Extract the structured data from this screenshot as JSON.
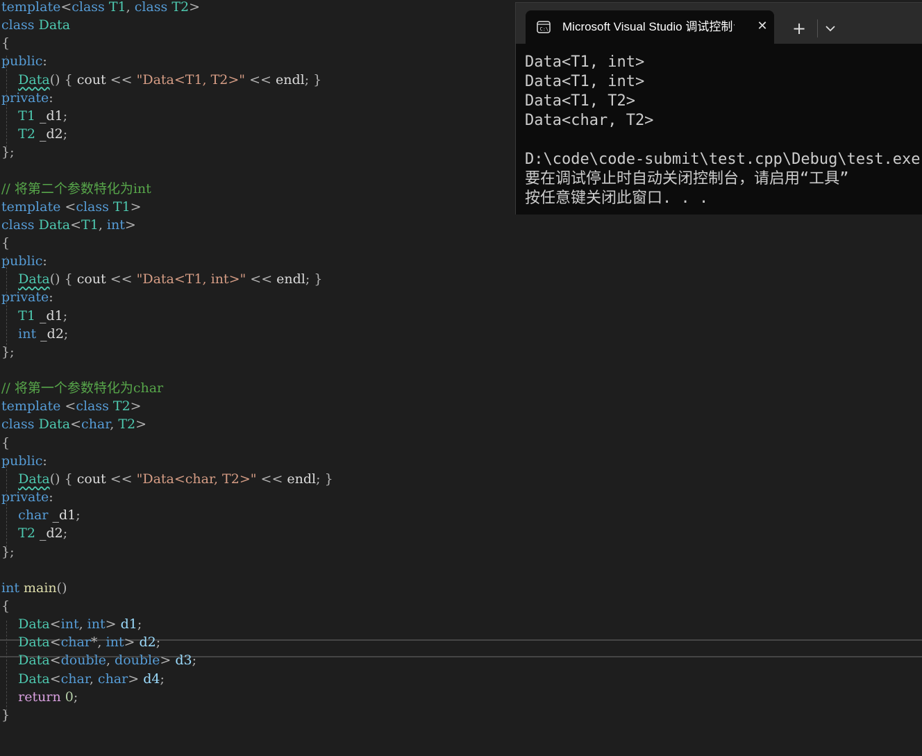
{
  "editor": {
    "lines": [
      [
        [
          "kw",
          "template"
        ],
        [
          "pu",
          "<"
        ],
        [
          "kw",
          "class"
        ],
        [
          "pl",
          " "
        ],
        [
          "ty",
          "T1"
        ],
        [
          "pu",
          ", "
        ],
        [
          "kw",
          "class"
        ],
        [
          "pl",
          " "
        ],
        [
          "ty",
          "T2"
        ],
        [
          "pu",
          ">"
        ]
      ],
      [
        [
          "kw",
          "class"
        ],
        [
          "pl",
          " "
        ],
        [
          "ty",
          "Data"
        ]
      ],
      [
        [
          "pu",
          "{"
        ]
      ],
      [
        [
          "kw",
          "public"
        ],
        [
          "pu",
          ":"
        ]
      ],
      [
        [
          "pl",
          "    "
        ],
        [
          "ty",
          "Data",
          "squig"
        ],
        [
          "pu",
          "() { "
        ],
        [
          "pl",
          "cout "
        ],
        [
          "pu",
          "<< "
        ],
        [
          "str",
          "\"Data<T1, T2>\""
        ],
        [
          "pu",
          " << "
        ],
        [
          "pl",
          "endl"
        ],
        [
          "pu",
          "; }"
        ]
      ],
      [
        [
          "kw",
          "private"
        ],
        [
          "pu",
          ":"
        ]
      ],
      [
        [
          "pl",
          "    "
        ],
        [
          "ty",
          "T1"
        ],
        [
          "pl",
          " _d1"
        ],
        [
          "pu",
          ";"
        ]
      ],
      [
        [
          "pl",
          "    "
        ],
        [
          "ty",
          "T2"
        ],
        [
          "pl",
          " _d2"
        ],
        [
          "pu",
          ";"
        ]
      ],
      [
        [
          "pu",
          "};"
        ]
      ],
      [],
      [
        [
          "cmt",
          "// 将第二个参数特化为int"
        ]
      ],
      [
        [
          "kw",
          "template"
        ],
        [
          "pl",
          " "
        ],
        [
          "pu",
          "<"
        ],
        [
          "kw",
          "class"
        ],
        [
          "pl",
          " "
        ],
        [
          "ty",
          "T1"
        ],
        [
          "pu",
          ">"
        ]
      ],
      [
        [
          "kw",
          "class"
        ],
        [
          "pl",
          " "
        ],
        [
          "ty",
          "Data"
        ],
        [
          "pu",
          "<"
        ],
        [
          "ty",
          "T1"
        ],
        [
          "pu",
          ", "
        ],
        [
          "kw",
          "int"
        ],
        [
          "pu",
          ">"
        ]
      ],
      [
        [
          "pu",
          "{"
        ]
      ],
      [
        [
          "kw",
          "public"
        ],
        [
          "pu",
          ":"
        ]
      ],
      [
        [
          "pl",
          "    "
        ],
        [
          "ty",
          "Data",
          "squig"
        ],
        [
          "pu",
          "() { "
        ],
        [
          "pl",
          "cout "
        ],
        [
          "pu",
          "<< "
        ],
        [
          "str",
          "\"Data<T1, int>\""
        ],
        [
          "pu",
          " << "
        ],
        [
          "pl",
          "endl"
        ],
        [
          "pu",
          "; }"
        ]
      ],
      [
        [
          "kw",
          "private"
        ],
        [
          "pu",
          ":"
        ]
      ],
      [
        [
          "pl",
          "    "
        ],
        [
          "ty",
          "T1"
        ],
        [
          "pl",
          " _d1"
        ],
        [
          "pu",
          ";"
        ]
      ],
      [
        [
          "pl",
          "    "
        ],
        [
          "kw",
          "int"
        ],
        [
          "pl",
          " _d2"
        ],
        [
          "pu",
          ";"
        ]
      ],
      [
        [
          "pu",
          "};"
        ]
      ],
      [],
      [
        [
          "cmt",
          "// 将第一个参数特化为char"
        ]
      ],
      [
        [
          "kw",
          "template"
        ],
        [
          "pl",
          " "
        ],
        [
          "pu",
          "<"
        ],
        [
          "kw",
          "class"
        ],
        [
          "pl",
          " "
        ],
        [
          "ty",
          "T2"
        ],
        [
          "pu",
          ">"
        ]
      ],
      [
        [
          "kw",
          "class"
        ],
        [
          "pl",
          " "
        ],
        [
          "ty",
          "Data"
        ],
        [
          "pu",
          "<"
        ],
        [
          "kw",
          "char"
        ],
        [
          "pu",
          ", "
        ],
        [
          "ty",
          "T2"
        ],
        [
          "pu",
          ">"
        ]
      ],
      [
        [
          "pu",
          "{"
        ]
      ],
      [
        [
          "kw",
          "public"
        ],
        [
          "pu",
          ":"
        ]
      ],
      [
        [
          "pl",
          "    "
        ],
        [
          "ty",
          "Data",
          "squig"
        ],
        [
          "pu",
          "() { "
        ],
        [
          "pl",
          "cout "
        ],
        [
          "pu",
          "<< "
        ],
        [
          "str",
          "\"Data<char, T2>\""
        ],
        [
          "pu",
          " << "
        ],
        [
          "pl",
          "endl"
        ],
        [
          "pu",
          "; }"
        ]
      ],
      [
        [
          "kw",
          "private"
        ],
        [
          "pu",
          ":"
        ]
      ],
      [
        [
          "pl",
          "    "
        ],
        [
          "kw",
          "char"
        ],
        [
          "pl",
          " _d1"
        ],
        [
          "pu",
          ";"
        ]
      ],
      [
        [
          "pl",
          "    "
        ],
        [
          "ty",
          "T2"
        ],
        [
          "pl",
          " _d2"
        ],
        [
          "pu",
          ";"
        ]
      ],
      [
        [
          "pu",
          "};"
        ]
      ],
      [],
      [
        [
          "kw",
          "int"
        ],
        [
          "pl",
          " "
        ],
        [
          "fn",
          "main"
        ],
        [
          "pu",
          "()"
        ]
      ],
      [
        [
          "pu",
          "{"
        ]
      ],
      [
        [
          "pl",
          "    "
        ],
        [
          "ty",
          "Data"
        ],
        [
          "pu",
          "<"
        ],
        [
          "kw",
          "int"
        ],
        [
          "pu",
          ", "
        ],
        [
          "kw",
          "int"
        ],
        [
          "pu",
          "> "
        ],
        [
          "vr",
          "d1"
        ],
        [
          "pu",
          ";"
        ]
      ],
      [
        [
          "pl",
          "    "
        ],
        [
          "ty",
          "Data"
        ],
        [
          "pu",
          "<"
        ],
        [
          "kw",
          "char"
        ],
        [
          "pu",
          "*, "
        ],
        [
          "kw",
          "int"
        ],
        [
          "pu",
          "> "
        ],
        [
          "vr",
          "d2"
        ],
        [
          "pu",
          ";"
        ]
      ],
      [
        [
          "pl",
          "    "
        ],
        [
          "ty",
          "Data"
        ],
        [
          "pu",
          "<"
        ],
        [
          "kw",
          "double"
        ],
        [
          "pu",
          ", "
        ],
        [
          "kw",
          "double"
        ],
        [
          "pu",
          "> "
        ],
        [
          "vr",
          "d3"
        ],
        [
          "pu",
          ";"
        ]
      ],
      [
        [
          "pl",
          "    "
        ],
        [
          "ty",
          "Data"
        ],
        [
          "pu",
          "<"
        ],
        [
          "kw",
          "char"
        ],
        [
          "pu",
          ", "
        ],
        [
          "kw",
          "char"
        ],
        [
          "pu",
          "> "
        ],
        [
          "vr",
          "d4"
        ],
        [
          "pu",
          ";"
        ]
      ],
      [
        [
          "pl",
          "    "
        ],
        [
          "ctl",
          "return"
        ],
        [
          "pl",
          " "
        ],
        [
          "nu",
          "0"
        ],
        [
          "pu",
          ";"
        ]
      ],
      [
        [
          "pu",
          "}"
        ]
      ]
    ],
    "current_line": 36
  },
  "console": {
    "tab_title": "Microsoft Visual Studio 调试控制台",
    "tab_icon": "terminal-icon",
    "close_icon": "close-icon",
    "new_tab_label": "+",
    "dropdown_icon": "chevron-down-icon",
    "output": [
      "Data<T1, int>",
      "Data<T1, int>",
      "Data<T1, T2>",
      "Data<char, T2>",
      "",
      "D:\\code\\code-submit\\test.cpp\\Debug\\test.exe",
      "要在调试停止时自动关闭控制台，请启用“工具”",
      "按任意键关闭此窗口. . ."
    ]
  },
  "colors": {
    "editor_bg": "#1e1e1e",
    "keyword": "#569cd6",
    "type": "#4ec9b0",
    "string": "#d69d85",
    "comment": "#57a64a",
    "console_bg": "#0c0c0c"
  }
}
